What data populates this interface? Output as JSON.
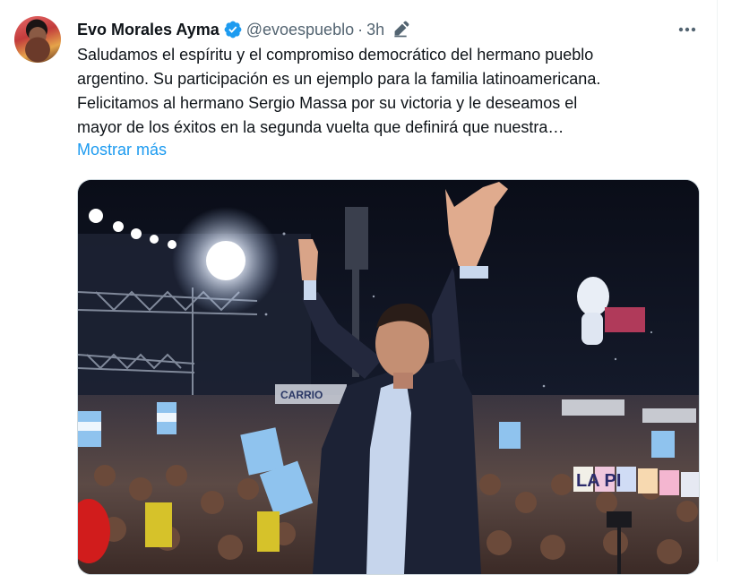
{
  "tweet": {
    "author_name": "Evo Morales Ayma",
    "handle": "@evoespueblo",
    "separator": "·",
    "time": "3h",
    "text_lines": [
      "Saludamos el espíritu y el compromiso democrático del hermano pueblo",
      "argentino. Su participación es un ejemplo para la familia latinoamericana.",
      "Felicitamos al hermano Sergio Massa por su victoria y le deseamos el",
      "mayor de los éxitos en la segunda vuelta que definirá que nuestra…"
    ],
    "show_more": "Mostrar más"
  },
  "media": {
    "banner_text": "LA PI",
    "sign_text": "CARRIO"
  },
  "icons": {
    "verified": "verified-badge-icon",
    "edit": "edited-icon",
    "more": "more-options-icon"
  },
  "colors": {
    "link": "#1d9bf0",
    "secondary_text": "#536471",
    "verified": "#1d9bf0"
  }
}
